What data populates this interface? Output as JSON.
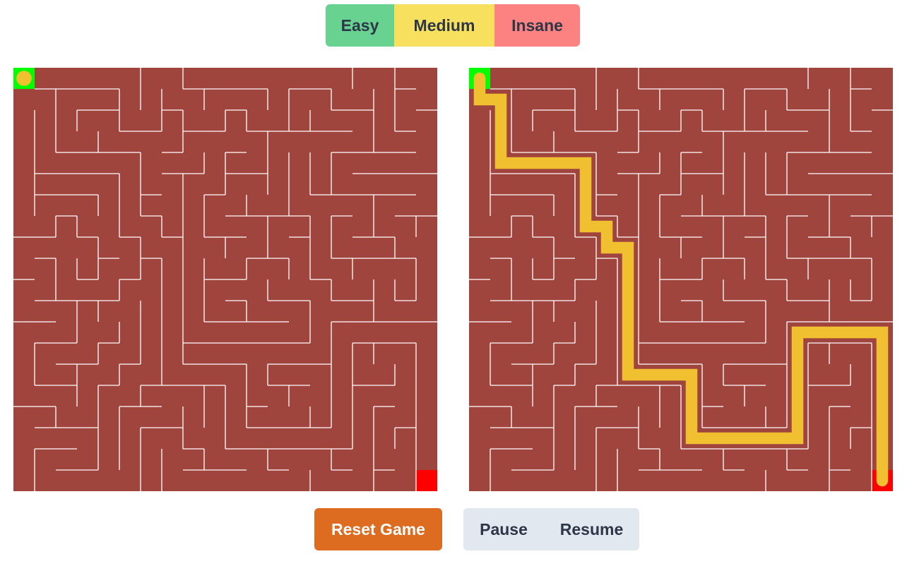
{
  "difficulty": {
    "easy": "Easy",
    "medium": "Medium",
    "insane": "Insane"
  },
  "controls": {
    "reset": "Reset Game",
    "pause": "Pause",
    "resume": "Resume"
  },
  "colors": {
    "maze_floor": "#a0453e",
    "wall": "#ffffff",
    "start": "#00ff00",
    "finish": "#ff0000",
    "player": "#f0c030",
    "path": "#f0c030",
    "easy": "#68d391",
    "medium": "#f6e05e",
    "insane": "#fc8181",
    "reset": "#dd6b20",
    "pause_resume_bg": "#e2e8f0"
  },
  "maze": {
    "rows": 20,
    "cols": 20,
    "player_cell": [
      0,
      0
    ],
    "start_cell": [
      0,
      0
    ],
    "finish_cell": [
      19,
      19
    ],
    "solution": [
      [
        0,
        0
      ],
      [
        1,
        0
      ],
      [
        1,
        1
      ],
      [
        2,
        1
      ],
      [
        3,
        1
      ],
      [
        4,
        1
      ],
      [
        4,
        2
      ],
      [
        4,
        3
      ],
      [
        4,
        4
      ],
      [
        4,
        5
      ],
      [
        5,
        5
      ],
      [
        6,
        5
      ],
      [
        7,
        5
      ],
      [
        7,
        6
      ],
      [
        8,
        6
      ],
      [
        8,
        7
      ],
      [
        9,
        7
      ],
      [
        10,
        7
      ],
      [
        11,
        7
      ],
      [
        12,
        7
      ],
      [
        13,
        7
      ],
      [
        14,
        7
      ],
      [
        14,
        8
      ],
      [
        14,
        9
      ],
      [
        14,
        10
      ],
      [
        15,
        10
      ],
      [
        16,
        10
      ],
      [
        17,
        10
      ],
      [
        17,
        11
      ],
      [
        17,
        12
      ],
      [
        17,
        13
      ],
      [
        17,
        14
      ],
      [
        17,
        15
      ],
      [
        16,
        15
      ],
      [
        15,
        15
      ],
      [
        14,
        15
      ],
      [
        13,
        15
      ],
      [
        12,
        15
      ],
      [
        12,
        16
      ],
      [
        12,
        17
      ],
      [
        12,
        18
      ],
      [
        12,
        19
      ],
      [
        13,
        19
      ],
      [
        14,
        19
      ],
      [
        15,
        19
      ],
      [
        16,
        19
      ],
      [
        17,
        19
      ],
      [
        18,
        19
      ],
      [
        19,
        19
      ]
    ]
  }
}
